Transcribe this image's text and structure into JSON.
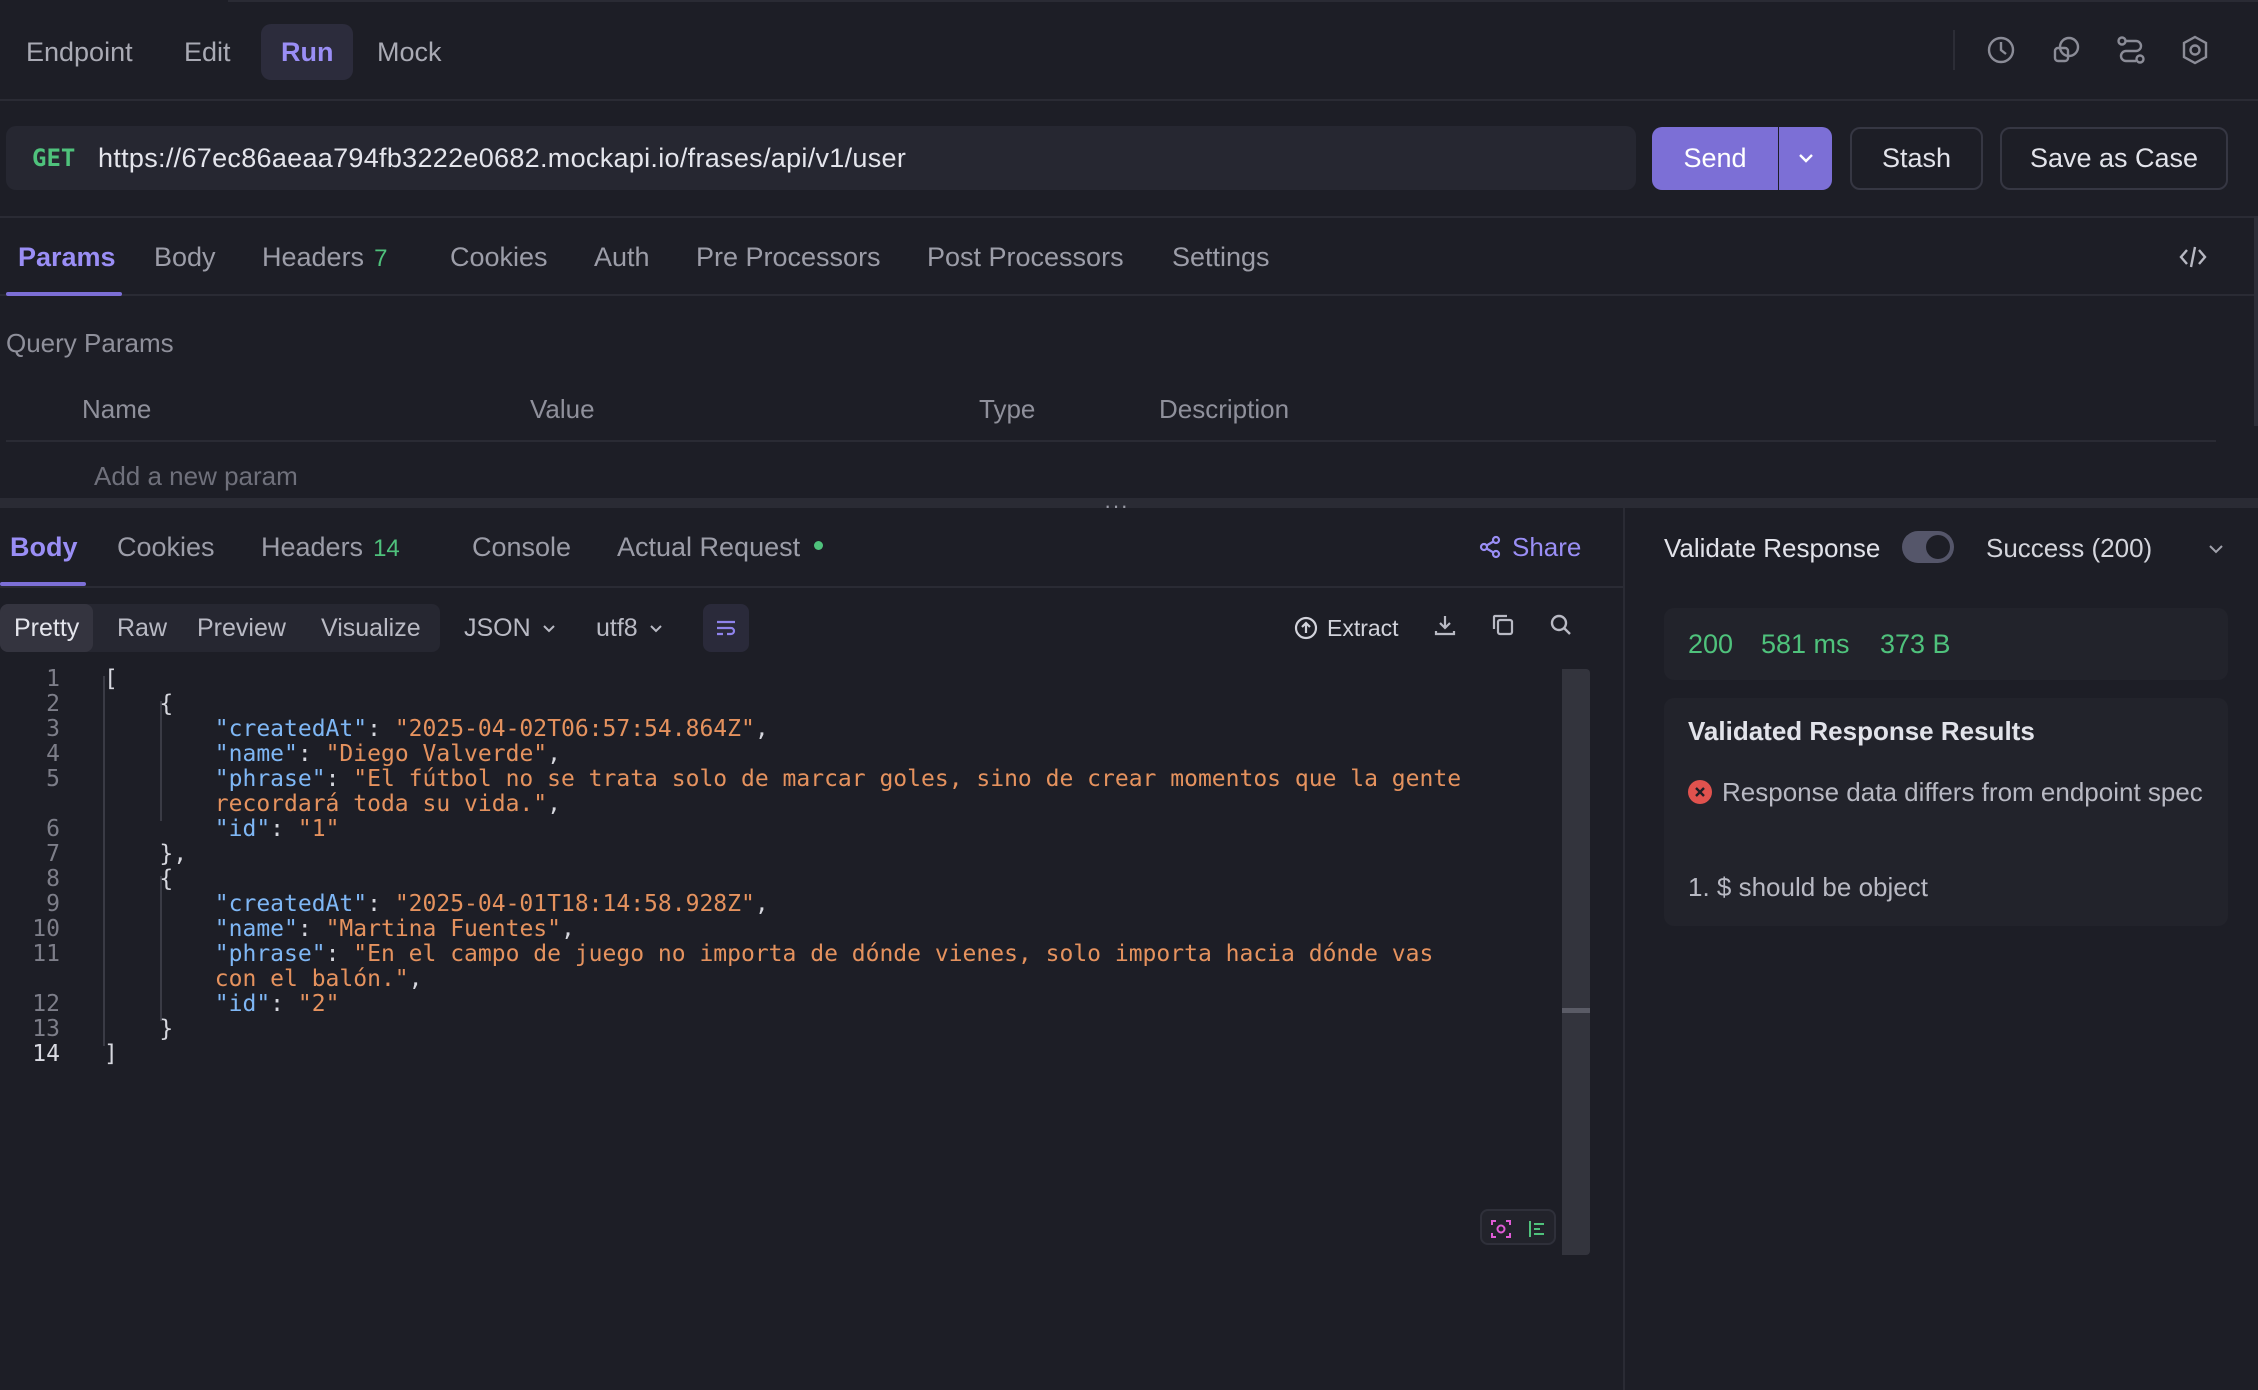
{
  "modes": {
    "endpoint": "Endpoint",
    "edit": "Edit",
    "run": "Run",
    "mock": "Mock"
  },
  "request": {
    "method": "GET",
    "url": "https://67ec86aeaa794fb3222e0682.mockapi.io/frases/api/v1/user",
    "send_label": "Send",
    "stash_label": "Stash",
    "save_case_label": "Save as Case"
  },
  "request_tabs": {
    "params": "Params",
    "body": "Body",
    "headers": "Headers",
    "headers_count": "7",
    "cookies": "Cookies",
    "auth": "Auth",
    "pre_processors": "Pre Processors",
    "post_processors": "Post Processors",
    "settings": "Settings"
  },
  "query_params": {
    "title": "Query Params",
    "columns": {
      "name": "Name",
      "value": "Value",
      "type": "Type",
      "description": "Description"
    },
    "add_placeholder": "Add a new param"
  },
  "splitter_label": "···",
  "response_tabs": {
    "body": "Body",
    "cookies": "Cookies",
    "headers": "Headers",
    "headers_count": "14",
    "console": "Console",
    "actual_request": "Actual Request",
    "share": "Share"
  },
  "view": {
    "pretty": "Pretty",
    "raw": "Raw",
    "preview": "Preview",
    "visualize": "Visualize",
    "format": "JSON",
    "encoding": "utf8",
    "extract": "Extract"
  },
  "editor": {
    "line_numbers": [
      "1",
      "2",
      "3",
      "4",
      "5",
      "",
      "6",
      "7",
      "8",
      "9",
      "10",
      "11",
      "",
      "12",
      "13",
      "14"
    ],
    "current_line": "14",
    "lines": [
      [
        [
          "p",
          "["
        ]
      ],
      [
        [
          "p",
          "    {"
        ]
      ],
      [
        [
          "p",
          "        "
        ],
        [
          "k",
          "\"createdAt\""
        ],
        [
          "p",
          ": "
        ],
        [
          "s",
          "\"2025-04-02T06:57:54.864Z\""
        ],
        [
          "p",
          ","
        ]
      ],
      [
        [
          "p",
          "        "
        ],
        [
          "k",
          "\"name\""
        ],
        [
          "p",
          ": "
        ],
        [
          "s",
          "\"Diego Valverde\""
        ],
        [
          "p",
          ","
        ]
      ],
      [
        [
          "p",
          "        "
        ],
        [
          "k",
          "\"phrase\""
        ],
        [
          "p",
          ": "
        ],
        [
          "s",
          "\"El fútbol no se trata solo de marcar goles, sino de crear momentos que la gente"
        ]
      ],
      [
        [
          "p",
          "        "
        ],
        [
          "s",
          "recordará toda su vida.\""
        ],
        [
          "p",
          ","
        ]
      ],
      [
        [
          "p",
          "        "
        ],
        [
          "k",
          "\"id\""
        ],
        [
          "p",
          ": "
        ],
        [
          "s",
          "\"1\""
        ]
      ],
      [
        [
          "p",
          "    },"
        ]
      ],
      [
        [
          "p",
          "    {"
        ]
      ],
      [
        [
          "p",
          "        "
        ],
        [
          "k",
          "\"createdAt\""
        ],
        [
          "p",
          ": "
        ],
        [
          "s",
          "\"2025-04-01T18:14:58.928Z\""
        ],
        [
          "p",
          ","
        ]
      ],
      [
        [
          "p",
          "        "
        ],
        [
          "k",
          "\"name\""
        ],
        [
          "p",
          ": "
        ],
        [
          "s",
          "\"Martina Fuentes\""
        ],
        [
          "p",
          ","
        ]
      ],
      [
        [
          "p",
          "        "
        ],
        [
          "k",
          "\"phrase\""
        ],
        [
          "p",
          ": "
        ],
        [
          "s",
          "\"En el campo de juego no importa de dónde vienes, solo importa hacia dónde vas"
        ]
      ],
      [
        [
          "p",
          "        "
        ],
        [
          "s",
          "con el balón.\""
        ],
        [
          "p",
          ","
        ]
      ],
      [
        [
          "p",
          "        "
        ],
        [
          "k",
          "\"id\""
        ],
        [
          "p",
          ": "
        ],
        [
          "s",
          "\"2\""
        ]
      ],
      [
        [
          "p",
          "    }"
        ]
      ],
      [
        [
          "p",
          "]"
        ]
      ]
    ]
  },
  "validate": {
    "label": "Validate Response",
    "toggle_on": true,
    "status_option": "Success (200)",
    "status_code": "200",
    "time": "581 ms",
    "size": "373 B",
    "results_title": "Validated Response Results",
    "error_message": "Response data differs from endpoint spec",
    "error_item": "1. $ should be object"
  },
  "colors": {
    "accent": "#7c6fd6",
    "accent_text": "#9a8ef5",
    "success": "#4fc27c",
    "error": "#e0524e",
    "json_key": "#7fb7f5",
    "json_string": "#e5925e"
  }
}
